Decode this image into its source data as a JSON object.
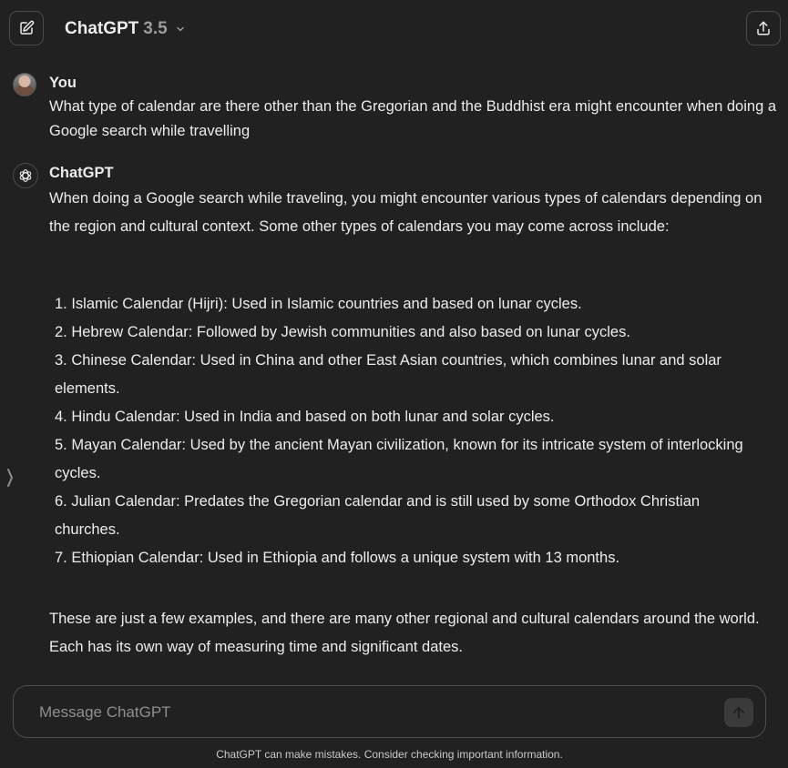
{
  "header": {
    "model_name": "ChatGPT",
    "model_version": "3.5",
    "icons": {
      "new_chat": "edit-icon",
      "model_dropdown": "chevron-down-icon",
      "share": "share-icon"
    }
  },
  "conversation": {
    "user_message": {
      "author": "You",
      "text": "What type of calendar are there other than the Gregorian and the Buddhist era might encounter when doing a Google search while travelling"
    },
    "assistant_message": {
      "author": "ChatGPT",
      "intro": "When doing a Google search while traveling, you might encounter various types of calendars depending on the region and cultural context. Some other types of calendars you may come across include:",
      "list": [
        "1. Islamic Calendar (Hijri): Used in Islamic countries and based on lunar cycles.",
        "2. Hebrew Calendar: Followed by Jewish communities and also based on lunar cycles.",
        "3. Chinese Calendar: Used in China and other East Asian countries, which combines lunar and solar elements.",
        "4. Hindu Calendar: Used in India and based on both lunar and solar cycles.",
        "5. Mayan Calendar: Used by the ancient Mayan civilization, known for its intricate system of interlocking cycles.",
        "6. Julian Calendar: Predates the Gregorian calendar and is still used by some Orthodox Christian churches.",
        "7. Ethiopian Calendar: Used in Ethiopia and follows a unique system with 13 months."
      ],
      "outro": "These are just a few examples, and there are many other regional and cultural calendars around the world. Each has its own way of measuring time and significant dates."
    }
  },
  "composer": {
    "placeholder": "Message ChatGPT",
    "send_icon": "arrow-up-icon"
  },
  "footer": {
    "note": "ChatGPT can make mistakes. Consider checking important information."
  },
  "colors": {
    "background": "#212121",
    "text": "#ececec",
    "muted": "#9b9b9b",
    "border": "#4a4a4a"
  }
}
